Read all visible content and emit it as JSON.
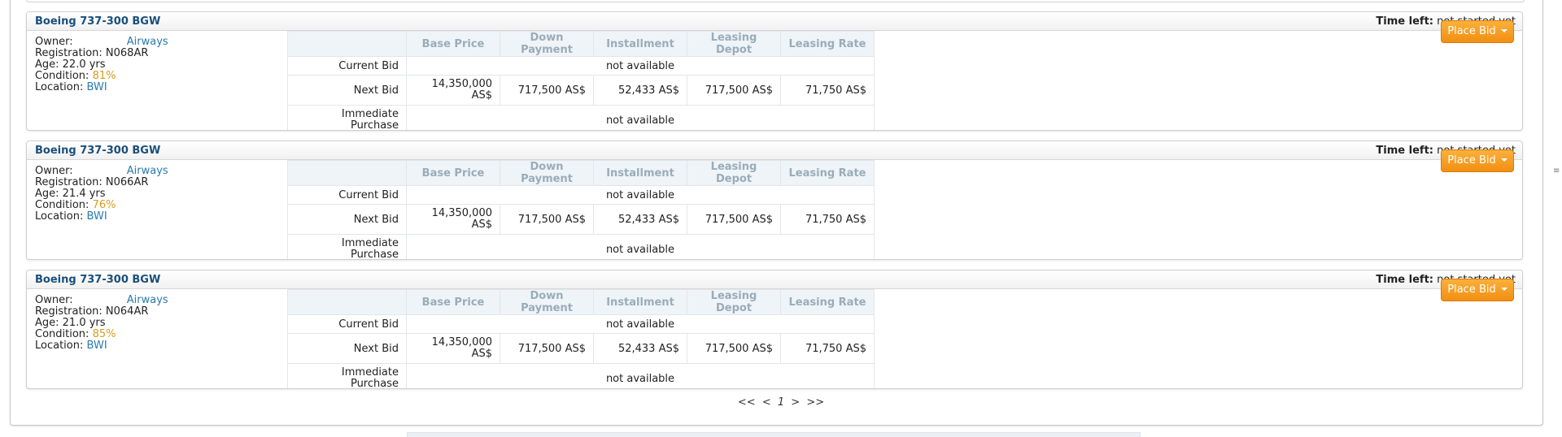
{
  "offers": [
    {
      "title": "Boeing 737-300 BGW",
      "time_left_label": "Time left:",
      "time_left_value": "not started yet",
      "owner_label": "Owner:",
      "owner_airline": "Airways",
      "registration": "Registration: N068AR",
      "age": "Age: 22.0 yrs",
      "condition_label": "Condition:",
      "condition_value": "81%",
      "location_label": "Location:",
      "location_value": "BWI",
      "bid_button": "Place Bid"
    },
    {
      "title": "Boeing 737-300 BGW",
      "time_left_label": "Time left:",
      "time_left_value": "not started yet",
      "owner_label": "Owner:",
      "owner_airline": "Airways",
      "registration": "Registration: N066AR",
      "age": "Age: 21.4 yrs",
      "condition_label": "Condition:",
      "condition_value": "76%",
      "location_label": "Location:",
      "location_value": "BWI",
      "bid_button": "Place Bid"
    },
    {
      "title": "Boeing 737-300 BGW",
      "time_left_label": "Time left:",
      "time_left_value": "not started yet",
      "owner_label": "Owner:",
      "owner_airline": "Airways",
      "registration": "Registration: N064AR",
      "age": "Age: 21.0 yrs",
      "condition_label": "Condition:",
      "condition_value": "85%",
      "location_label": "Location:",
      "location_value": "BWI",
      "bid_button": "Place Bid"
    }
  ],
  "price_table": {
    "headers": [
      "Base Price",
      "Down Payment",
      "Installment",
      "Leasing Depot",
      "Leasing Rate"
    ],
    "current_bid_label": "Current Bid",
    "current_bid_value": "not available",
    "next_bid_label": "Next Bid",
    "next_bid_values": [
      "14,350,000 AS$",
      "717,500 AS$",
      "52,433 AS$",
      "717,500 AS$",
      "71,750 AS$"
    ],
    "immediate_label": "Immediate Purchase",
    "immediate_value": "not available"
  },
  "pager": {
    "first": "<<",
    "prev": "<",
    "current": "1",
    "next": ">",
    "last": ">>"
  },
  "colors": {
    "title": "#1a4f7a",
    "link": "#2a7ab0",
    "condition": "#d99b1c",
    "button": "#f5a020",
    "header_text": "#9aacb9"
  }
}
